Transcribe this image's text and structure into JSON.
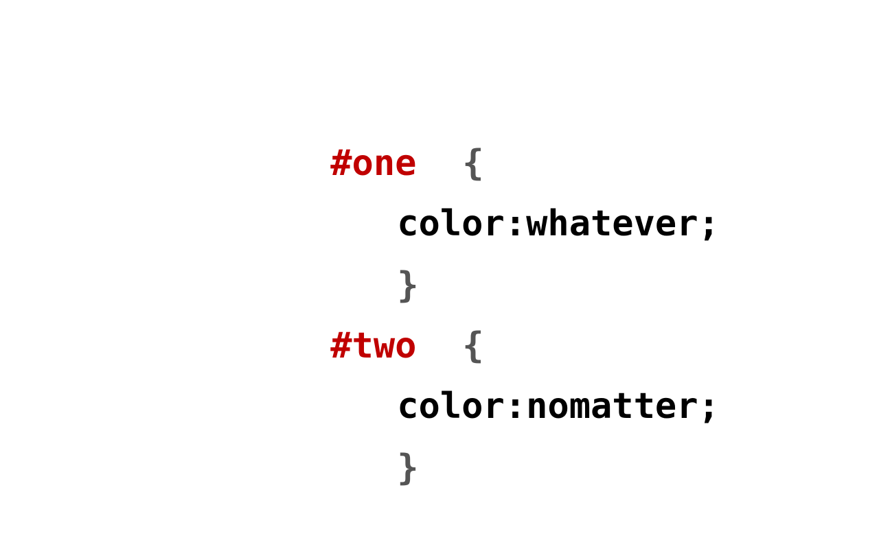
{
  "colors": {
    "selector": "#c00000",
    "brace": "#555555",
    "declaration": "#000000",
    "background": "#ffffff"
  },
  "rules": [
    {
      "selector": "#one",
      "open_brace": "{",
      "declaration": "color:whatever;",
      "close_brace": "}"
    },
    {
      "selector": "#two",
      "open_brace": "{",
      "declaration": "color:nomatter;",
      "close_brace": "}"
    }
  ]
}
